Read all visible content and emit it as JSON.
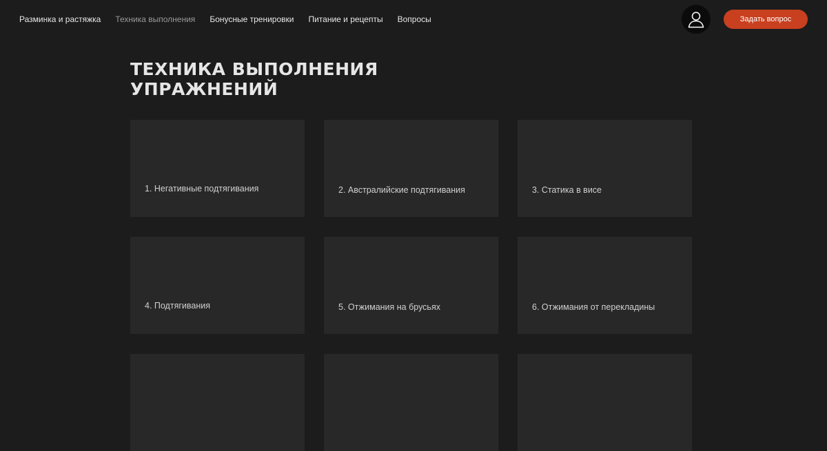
{
  "nav": {
    "items": [
      {
        "label": "Разминка и растяжка",
        "active": false
      },
      {
        "label": "Техника выполнения",
        "active": true
      },
      {
        "label": "Бонусные тренировки",
        "active": false
      },
      {
        "label": "Питание и рецепты",
        "active": false
      },
      {
        "label": "Вопросы",
        "active": false
      }
    ]
  },
  "header": {
    "avatar_icon": "user-icon",
    "cta_label": "Задать вопрос",
    "cta_color": "#c8401f"
  },
  "page": {
    "title_line1": "Техника выполнения",
    "title_line2": "упражнений"
  },
  "cards": [
    {
      "label": "1. Негативные подтягивания"
    },
    {
      "label": "2. Австралийские подтягивания"
    },
    {
      "label": "3. Статика в висе"
    },
    {
      "label": "4. Подтягивания"
    },
    {
      "label": "5. Отжимания на брусьях"
    },
    {
      "label": "6. Отжимания от перекладины"
    },
    {
      "label": ""
    },
    {
      "label": ""
    },
    {
      "label": ""
    }
  ],
  "colors": {
    "background": "#1c1c1c",
    "card": "#282828",
    "accent": "#c8401f"
  }
}
